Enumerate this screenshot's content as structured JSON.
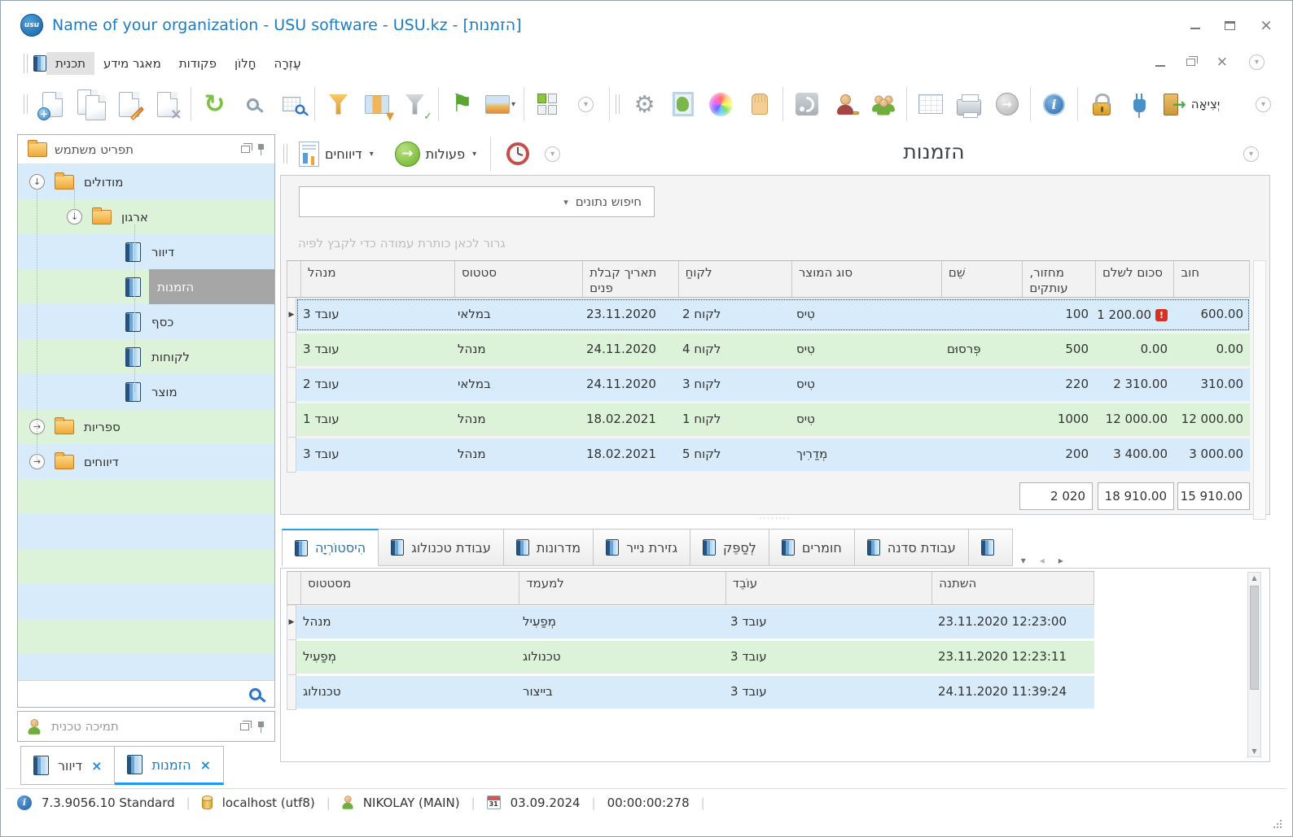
{
  "window": {
    "title": "Name of your organization - USU software - USU.kz - [הזמנות]",
    "logo": "usu"
  },
  "menu": {
    "items": [
      "תכנית",
      "מאגר מידע",
      "פקודות",
      "חָלוֹן",
      "עֶזְרָה"
    ]
  },
  "toolbar": {
    "exit_label": "יְצִיאָה"
  },
  "sidebar": {
    "title": "תפריט משתמש",
    "tree": [
      {
        "label": "מודולים"
      },
      {
        "label": "ארגון"
      },
      {
        "label": "דיוור"
      },
      {
        "label": "הזמנות"
      },
      {
        "label": "כסף"
      },
      {
        "label": "לקוחות"
      },
      {
        "label": "מוצר"
      },
      {
        "label": "ספריות"
      },
      {
        "label": "דיווחים"
      }
    ],
    "support_title": "תמיכה טכנית"
  },
  "content": {
    "title": "הזמנות",
    "reports_button": "דיווחים",
    "actions_button": "פעולות",
    "search_placeholder": "חיפוש נתונים",
    "group_hint": "גרור לכאן כותרת עמודה כדי לקבץ לפיה",
    "orders": {
      "columns": [
        "מנהל",
        "סטטוס",
        "תאריך קבלת פנים",
        "לקוחַ",
        "סוג המוצר",
        "שֵׁם",
        "מחזור, עותקים",
        "סכום לשלם",
        "חוב"
      ],
      "rows": [
        [
          "עובד 3",
          "במלאי",
          "23.11.2020",
          "לקוח 2",
          "טִיס",
          "",
          "100",
          "1 200.00",
          "600.00"
        ],
        [
          "עובד 3",
          "מנהל",
          "24.11.2020",
          "לקוח 4",
          "טִיס",
          "פְּרסוּם",
          "500",
          "0.00",
          "0.00"
        ],
        [
          "עובד 2",
          "במלאי",
          "24.11.2020",
          "לקוח 3",
          "טִיס",
          "",
          "220",
          "2 310.00",
          "310.00"
        ],
        [
          "עובד 1",
          "מנהל",
          "18.02.2021",
          "לקוח 1",
          "טִיס",
          "",
          "1000",
          "12 000.00",
          "12 000.00"
        ],
        [
          "עובד 3",
          "מנהל",
          "18.02.2021",
          "לקוח 5",
          "מְדַרִיך",
          "",
          "200",
          "3 400.00",
          "3 000.00"
        ]
      ],
      "summary": {
        "circulation": "2 020",
        "amount": "18 910.00",
        "debt": "15 910.00"
      }
    },
    "detail_tabs": [
      "הִיסטוֹרְיָה",
      "עבודת טכנולוג",
      "מדרונות",
      "גזירת נייר",
      "לְסַפֵּק",
      "חומרים",
      "עבודת סדנה"
    ],
    "history": {
      "columns": [
        "מסטטוס",
        "למעמד",
        "עוֹבֵד",
        "השתנה"
      ],
      "rows": [
        [
          "מנהל",
          "מְפַעִיל",
          "עובד 3",
          "23.11.2020 12:23:00"
        ],
        [
          "מְפַעִיל",
          "טכנולוג",
          "עובד 3",
          "23.11.2020 12:23:11"
        ],
        [
          "טכנולוג",
          "בייצור",
          "עובד 3",
          "24.11.2020 11:39:24"
        ]
      ]
    }
  },
  "window_tabs": [
    {
      "label": "דיוור"
    },
    {
      "label": "הזמנות"
    }
  ],
  "statusbar": {
    "version": "7.3.9056.10 Standard",
    "database": "localhost (utf8)",
    "user": "NIKOLAY (MAIN)",
    "calendar_day": "31",
    "date": "03.09.2024",
    "timer": "00:00:00:278"
  },
  "colors": {
    "accent_blue": "#1a7dc2",
    "row_blue": "#d7ebfa",
    "row_green": "#dcf3da",
    "selection_gray": "#a6a6a6",
    "warning_red": "#d93025",
    "tab_underline": "#2196f3"
  }
}
